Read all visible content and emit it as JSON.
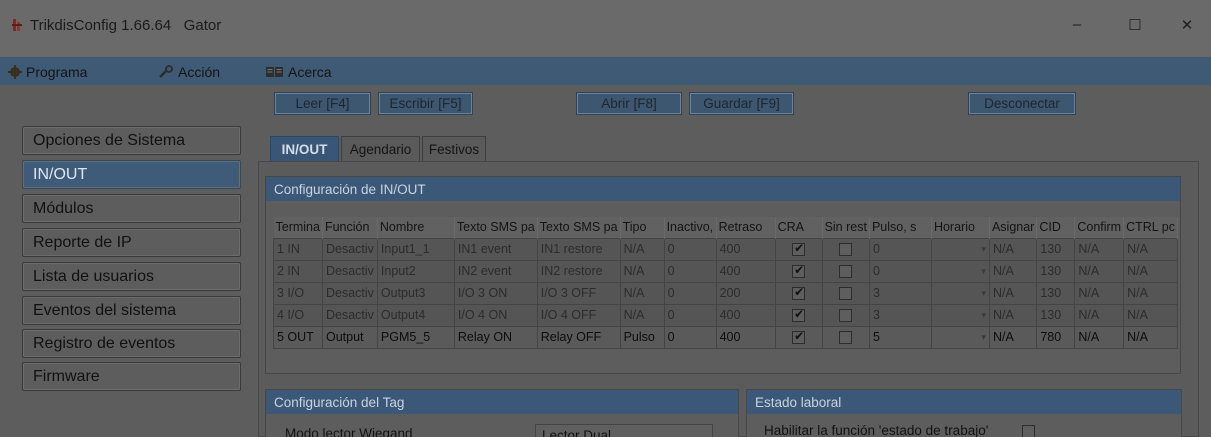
{
  "window": {
    "title": "TrikdisConfig 1.66.64   Gator",
    "minimize": "–",
    "maximize": "☐",
    "close": "✕"
  },
  "menu": {
    "programa": "Programa",
    "accion": "Acción",
    "acerca": "Acerca"
  },
  "toolbar": {
    "leer": "Leer [F4]",
    "escribir": "Escribir [F5]",
    "abrir": "Abrir [F8]",
    "guardar": "Guardar [F9]",
    "desconectar": "Desconectar"
  },
  "sidebar": {
    "items": [
      {
        "label": "Opciones de Sistema"
      },
      {
        "label": "IN/OUT"
      },
      {
        "label": "Módulos"
      },
      {
        "label": "Reporte de IP"
      },
      {
        "label": "Lista de usuarios"
      },
      {
        "label": "Eventos del sistema"
      },
      {
        "label": "Registro de eventos"
      },
      {
        "label": "Firmware"
      }
    ],
    "active_index": 1
  },
  "tabs": [
    {
      "label": "IN/OUT"
    },
    {
      "label": "Agendario"
    },
    {
      "label": "Festivos"
    }
  ],
  "inout_panel": {
    "title": "Configuración de IN/OUT",
    "columns": [
      "Termina",
      "Función",
      "Nombre",
      "Texto SMS pa",
      "Texto SMS pa",
      "Tipo",
      "Inactivo,",
      "Retraso",
      "CRA",
      "Sin rest",
      "Pulso, s",
      "Horario",
      "Asignar",
      "CID",
      "Confirm",
      "CTRL pc"
    ],
    "rows": [
      {
        "terminal": "1 IN",
        "funcion": "Desactiv",
        "nombre": "Input1_1",
        "sms_on": "IN1 event",
        "sms_off": "IN1 restore",
        "tipo": "N/A",
        "inactivo": "0",
        "retraso": "400",
        "cra": true,
        "sin_rest": false,
        "pulso": "0",
        "horario": "",
        "asignar": "N/A",
        "cid": "130",
        "confirm": "N/A",
        "ctrl": "N/A"
      },
      {
        "terminal": "2 IN",
        "funcion": "Desactiv",
        "nombre": "Input2",
        "sms_on": "IN2 event",
        "sms_off": "IN2 restore",
        "tipo": "N/A",
        "inactivo": "0",
        "retraso": "400",
        "cra": true,
        "sin_rest": false,
        "pulso": "0",
        "horario": "",
        "asignar": "N/A",
        "cid": "130",
        "confirm": "N/A",
        "ctrl": "N/A"
      },
      {
        "terminal": "3 I/O",
        "funcion": "Desactiv",
        "nombre": "Output3",
        "sms_on": "I/O 3 ON",
        "sms_off": "I/O 3 OFF",
        "tipo": "N/A",
        "inactivo": "0",
        "retraso": "200",
        "cra": true,
        "sin_rest": false,
        "pulso": "3",
        "horario": "",
        "asignar": "N/A",
        "cid": "130",
        "confirm": "N/A",
        "ctrl": "N/A"
      },
      {
        "terminal": "4 I/O",
        "funcion": "Desactiv",
        "nombre": "Output4",
        "sms_on": "I/O 4 ON",
        "sms_off": "I/O 4 OFF",
        "tipo": "N/A",
        "inactivo": "0",
        "retraso": "400",
        "cra": true,
        "sin_rest": false,
        "pulso": "3",
        "horario": "",
        "asignar": "N/A",
        "cid": "130",
        "confirm": "N/A",
        "ctrl": "N/A"
      },
      {
        "terminal": "5 OUT",
        "funcion": "Output",
        "nombre": "PGM5_5",
        "sms_on": "Relay ON",
        "sms_off": "Relay OFF",
        "tipo": "Pulso",
        "inactivo": "0",
        "retraso": "400",
        "cra": true,
        "sin_rest": false,
        "pulso": "5",
        "horario": "",
        "asignar": "N/A",
        "cid": "780",
        "confirm": "N/A",
        "ctrl": "N/A"
      }
    ]
  },
  "tag_panel": {
    "title": "Configuración del Tag",
    "wiegand_label": "Modo lector Wiegand",
    "wiegand_value": "Lector Dual"
  },
  "work_panel": {
    "title": "Estado laboral",
    "enable_label": "Habilitar la función 'estado de trabajo'",
    "enable_checked": false
  },
  "colors": {
    "accent": "#3e5b79",
    "header": "#3c5878",
    "background": "#5d5d5d"
  }
}
